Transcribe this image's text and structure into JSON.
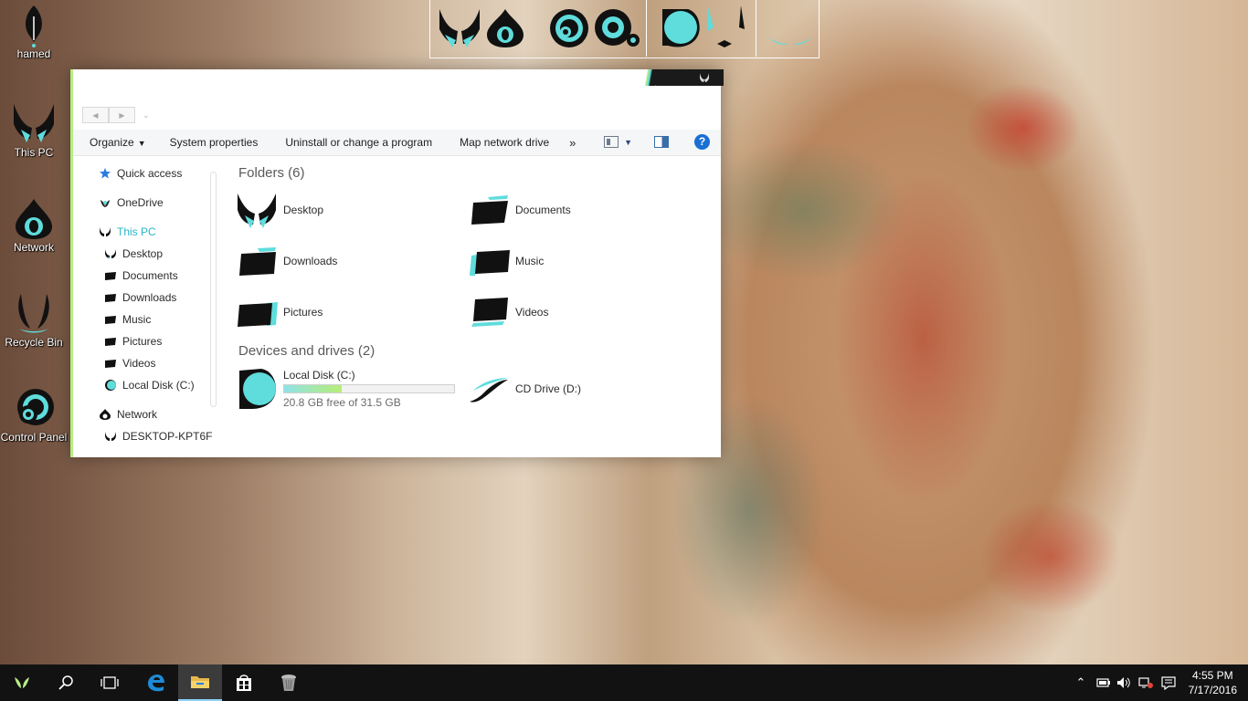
{
  "desktop": {
    "icons": [
      {
        "label": "hamed",
        "icon": "user-leaf-icon"
      },
      {
        "label": "This PC",
        "icon": "butterfly-icon"
      },
      {
        "label": "Network",
        "icon": "network-drop-icon"
      },
      {
        "label": "Recycle Bin",
        "icon": "horns-icon"
      },
      {
        "label": "Control Panel",
        "icon": "rings-icon"
      }
    ]
  },
  "explorer": {
    "toolbar": {
      "organize": "Organize",
      "system_properties": "System properties",
      "uninstall": "Uninstall or change a program",
      "map_drive": "Map network drive",
      "more": "»",
      "help": "?"
    },
    "nav": {
      "quick_access": "Quick access",
      "onedrive": "OneDrive",
      "this_pc": "This PC",
      "desktop": "Desktop",
      "documents": "Documents",
      "downloads": "Downloads",
      "music": "Music",
      "pictures": "Pictures",
      "videos": "Videos",
      "local_disk": "Local Disk (C:)",
      "network": "Network",
      "desktop_host": "DESKTOP-KPT6F"
    },
    "folders_title": "Folders (6)",
    "folders": [
      "Desktop",
      "Documents",
      "Downloads",
      "Music",
      "Pictures",
      "Videos"
    ],
    "devices_title": "Devices and drives (2)",
    "drive_c": {
      "name": "Local Disk (C:)",
      "free": "20.8 GB free of 31.5 GB",
      "used_fraction": 0.34
    },
    "drive_d": {
      "name": "CD Drive (D:)"
    }
  },
  "taskbar": {
    "time": "4:55 PM",
    "date": "7/17/2016"
  },
  "colors": {
    "accent": "#5fdcdc",
    "accent_green": "#b7ed84",
    "taskbar": "#121212"
  }
}
